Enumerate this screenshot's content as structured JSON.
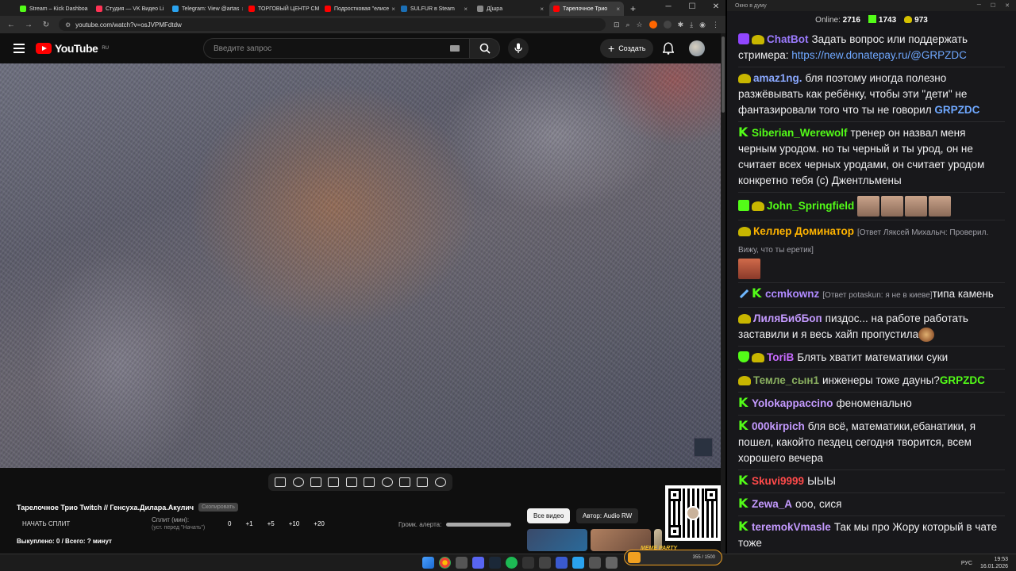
{
  "browser": {
    "tabs": [
      {
        "title": "Stream – Kick Dashboa",
        "color": "#53fc18"
      },
      {
        "title": "Студия — VK Видео Li",
        "color": "#ff3355"
      },
      {
        "title": "Telegram: View @artas",
        "color": "#2aa3ef"
      },
      {
        "title": "ТОРГОВЫЙ ЦЕНТР СМ",
        "color": "#ff0000"
      },
      {
        "title": "Подростковая \"елисе",
        "color": "#ff0000"
      },
      {
        "title": "SULFUR в Steam",
        "color": "#1b6fb5"
      },
      {
        "title": "Д[шра",
        "color": "#888888"
      },
      {
        "title": "Тарелочное Трио",
        "color": "#ff0000"
      }
    ],
    "new_tab": "+",
    "url": "youtube.com/watch?v=osJVPMFdtdw"
  },
  "youtube": {
    "logo_text": "YouTube",
    "region": "RU",
    "search_placeholder": "Введите запрос",
    "create_label": "Создать"
  },
  "panel": {
    "title": "Тарелочное Трио Twitch // Генсуха.Дилара.Акулич",
    "title_chip": "Скопировать",
    "start_split": "НАЧАТЬ СПЛИТ",
    "split_label": "Сплит (мин):",
    "split_sub": "(уст. перед \"Начать\")",
    "split_values": [
      "0",
      "+1",
      "+5",
      "+10",
      "+20"
    ],
    "bought": "Выкуплено: 0 / Всего: ? минут",
    "alert_label": "Громк. алерта:",
    "chips": {
      "all": "Все видео",
      "author": "Автор: Audio RW"
    }
  },
  "chat": {
    "window_title": "Окно в думу",
    "online_label": "Online:",
    "online_count": "2716",
    "kick_count": "1743",
    "other_count": "973",
    "messages": [
      {
        "user": "ChatBot",
        "color": "#9c7bff",
        "text": "Задать вопрос или поддержать стримера: ",
        "link": "https://new.donatepay.ru/@GRPZDC"
      },
      {
        "user": "amaz1ng.",
        "color": "#8aa8ff",
        "text": "бля поэтому иногда полезно разжёвывать как ребёнку, чтобы эти \"дети\" не фантазировали того что ты не говорил ",
        "tag": "GRPZDC"
      },
      {
        "user": "Siberian_Werewolf",
        "color": "#53fc18",
        "text": "тренер он назвал меня черным уродом. но ты черный и ты урод, он не считает всех черных уродами, он считает уродом конкретно тебя (с) Джентльмены"
      },
      {
        "user": "John_Springfield",
        "color": "#53fc18",
        "text": ""
      },
      {
        "user": "Келлер Доминатор",
        "color": "#ffb400",
        "reply": "[Ответ Ляксей Михалыч: Проверил. Вижу, что ты еретик]",
        "text": ""
      },
      {
        "user": "ccmkownz",
        "color": "#b08aff",
        "reply": "[Ответ potaskun: я не в киеве]",
        "text": "типа камень"
      },
      {
        "user": "ЛиляБибБоп",
        "color": "#c49aff",
        "text": "пиздос... на работе работать заставили и я весь хайп пропустила"
      },
      {
        "user": "ToriB",
        "color": "#c86bff",
        "text": "Блять хватит математики суки"
      },
      {
        "user": "Темле_сын1",
        "color": "#8ab060",
        "text": "инженеры тоже дауны?",
        "tag": "GRPZDC"
      },
      {
        "user": "Yolokappaccino",
        "color": "#c49aff",
        "text": "феноменально"
      },
      {
        "user": "000kirpich",
        "color": "#c49aff",
        "text": "бля всё, математики,ебанатики, я пошел, какойто пездец сегодня творится, всем хорошего вечера"
      },
      {
        "user": "Skuvi9999",
        "color": "#ff4a4a",
        "text": "ЫЫЫ"
      },
      {
        "user": "Zewa_A",
        "color": "#c49aff",
        "text": "ооо, сися"
      },
      {
        "user": "teremokVmasle",
        "color": "#c49aff",
        "text": "Так мы про Жору который в чате тоже"
      }
    ]
  },
  "meme_party": {
    "title": "MEME PARTY",
    "count": "355 / 1500"
  },
  "taskbar": {
    "lang": "РУС",
    "time": "19:53",
    "date": "16.01.2026"
  }
}
